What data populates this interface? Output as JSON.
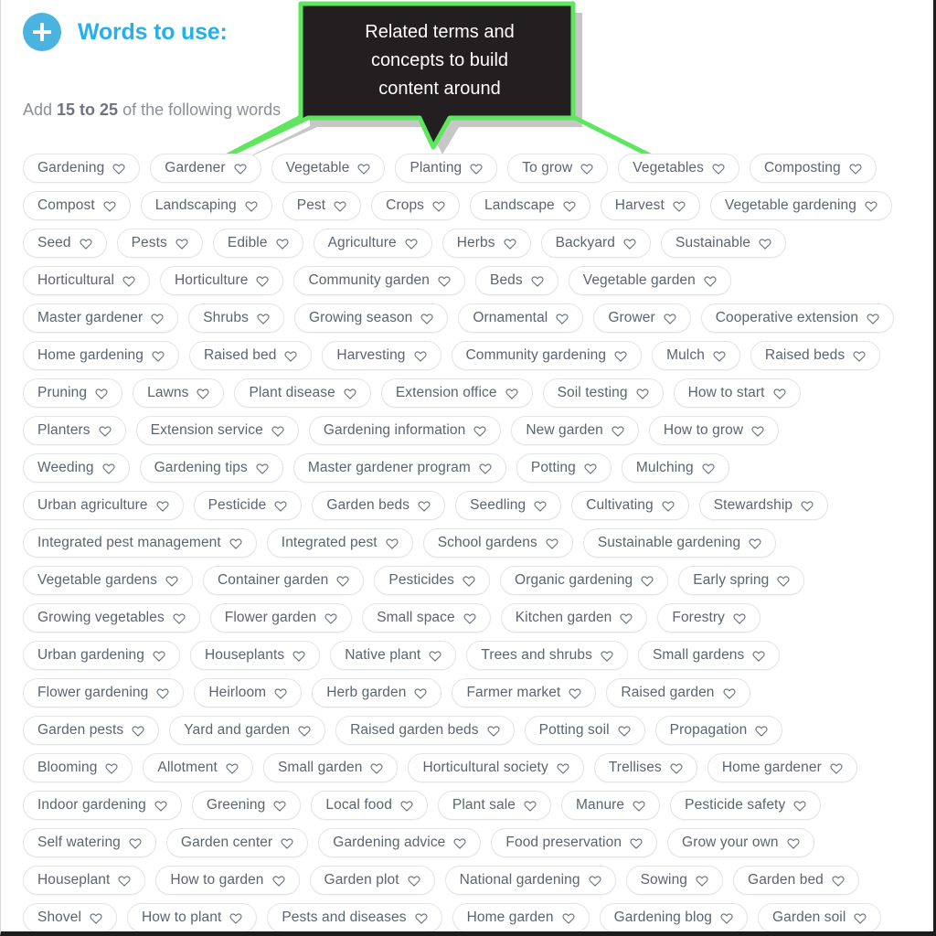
{
  "header": {
    "add_icon": "plus-circle-icon",
    "title": "Words to use:",
    "accent_color": "#24b0e8",
    "badge_color": "#4bb3e0"
  },
  "subtitle": {
    "prefix": "Add ",
    "emphasis": "15 to 25",
    "suffix": " of the following words"
  },
  "callout": {
    "text": "Related terms and concepts to build content around",
    "line1": "Related terms and",
    "line2": "concepts to build",
    "line3": "content around",
    "background_color": "#231f20",
    "border_color": "#5ee65e"
  },
  "tag_icon": "heart-outline-icon",
  "tag_rows": [
    [
      "Gardening",
      "Gardener",
      "Vegetable",
      "Planting",
      "To grow",
      "Vegetables",
      "Composting"
    ],
    [
      "Compost",
      "Landscaping",
      "Pest",
      "Crops",
      "Landscape",
      "Harvest",
      "Vegetable gardening"
    ],
    [
      "Seed",
      "Pests",
      "Edible",
      "Agriculture",
      "Herbs",
      "Backyard",
      "Sustainable"
    ],
    [
      "Horticultural",
      "Horticulture",
      "Community garden",
      "Beds",
      "Vegetable garden"
    ],
    [
      "Master gardener",
      "Shrubs",
      "Growing season",
      "Ornamental",
      "Grower",
      "Cooperative extension"
    ],
    [
      "Home gardening",
      "Raised bed",
      "Harvesting",
      "Community gardening",
      "Mulch",
      "Raised beds"
    ],
    [
      "Pruning",
      "Lawns",
      "Plant disease",
      "Extension office",
      "Soil testing",
      "How to start"
    ],
    [
      "Planters",
      "Extension service",
      "Gardening information",
      "New garden",
      "How to grow"
    ],
    [
      "Weeding",
      "Gardening tips",
      "Master gardener program",
      "Potting",
      "Mulching"
    ],
    [
      "Urban agriculture",
      "Pesticide",
      "Garden beds",
      "Seedling",
      "Cultivating",
      "Stewardship"
    ],
    [
      "Integrated pest management",
      "Integrated pest",
      "School gardens",
      "Sustainable gardening"
    ],
    [
      "Vegetable gardens",
      "Container garden",
      "Pesticides",
      "Organic gardening",
      "Early spring"
    ],
    [
      "Growing vegetables",
      "Flower garden",
      "Small space",
      "Kitchen garden",
      "Forestry"
    ],
    [
      "Urban gardening",
      "Houseplants",
      "Native plant",
      "Trees and shrubs",
      "Small gardens"
    ],
    [
      "Flower gardening",
      "Heirloom",
      "Herb garden",
      "Farmer market",
      "Raised garden"
    ],
    [
      "Garden pests",
      "Yard and garden",
      "Raised garden beds",
      "Potting soil",
      "Propagation"
    ],
    [
      "Blooming",
      "Allotment",
      "Small garden",
      "Horticultural society",
      "Trellises",
      "Home gardener"
    ],
    [
      "Indoor gardening",
      "Greening",
      "Local food",
      "Plant sale",
      "Manure",
      "Pesticide safety"
    ],
    [
      "Self watering",
      "Garden center",
      "Gardening advice",
      "Food preservation",
      "Grow your own"
    ],
    [
      "Houseplant",
      "How to garden",
      "Garden plot",
      "National gardening",
      "Sowing",
      "Garden bed"
    ],
    [
      "Shovel",
      "How to plant",
      "Pests and diseases",
      "Home garden",
      "Gardening blog",
      "Garden soil"
    ]
  ]
}
